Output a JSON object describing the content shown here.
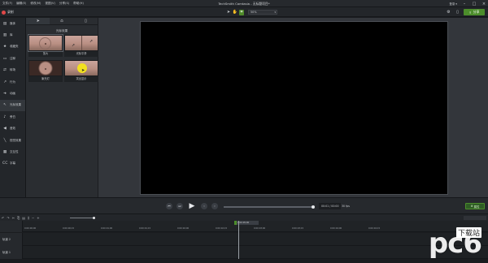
{
  "menu": [
    "文件(F)",
    "编辑(E)",
    "修改(M)",
    "视图(V)",
    "分享(S)",
    "帮助(H)"
  ],
  "app_title": "TechSmith Camtasia - 无标题项目*",
  "signin": "登录 ▾",
  "toolbar": {
    "record_label": "录制",
    "zoom_value": "50%",
    "share_label": "分享"
  },
  "sidebar": {
    "items": [
      {
        "icon": "▤",
        "label": "媒体"
      },
      {
        "icon": "▥",
        "label": "库"
      },
      {
        "icon": "★",
        "label": "收藏夹"
      },
      {
        "icon": "▭",
        "label": "注释"
      },
      {
        "icon": "⇄",
        "label": "转场"
      },
      {
        "icon": "↗",
        "label": "行为"
      },
      {
        "icon": "➜",
        "label": "动画"
      },
      {
        "icon": "↖",
        "label": "光标效果"
      },
      {
        "icon": "♪",
        "label": "旁白"
      },
      {
        "icon": "◀",
        "label": "音效"
      },
      {
        "icon": "╲",
        "label": "视觉效果"
      },
      {
        "icon": "▦",
        "label": "交互性"
      },
      {
        "icon": "CC",
        "label": "字幕"
      }
    ]
  },
  "panel": {
    "title": "光标效果",
    "effects": [
      {
        "label": "放大"
      },
      {
        "label": "光标平滑"
      },
      {
        "label": "聚光灯"
      },
      {
        "label": "突出显示"
      }
    ]
  },
  "playback": {
    "time": "00:01 / 00:00",
    "fps": "30 fps",
    "props_label": "属性"
  },
  "timeline": {
    "playhead": "0:00:05;00",
    "ticks": [
      "0:00:00;00",
      "0:00:00;15",
      "0:00:01;00",
      "0:00:01;15",
      "0:00:02;00",
      "0:00:02;15",
      "0:00:03;00",
      "0:00:03;15",
      "0:00:04;00",
      "0:00:04;15"
    ],
    "tracks": [
      "轨道 2",
      "轨道 1"
    ]
  },
  "watermark": {
    "brand": "pc6",
    "sub": "下载站"
  },
  "colors": {
    "accent_green": "#4c8d2b",
    "record_red": "#e04848",
    "highlight_yellow": "#f2e020"
  }
}
